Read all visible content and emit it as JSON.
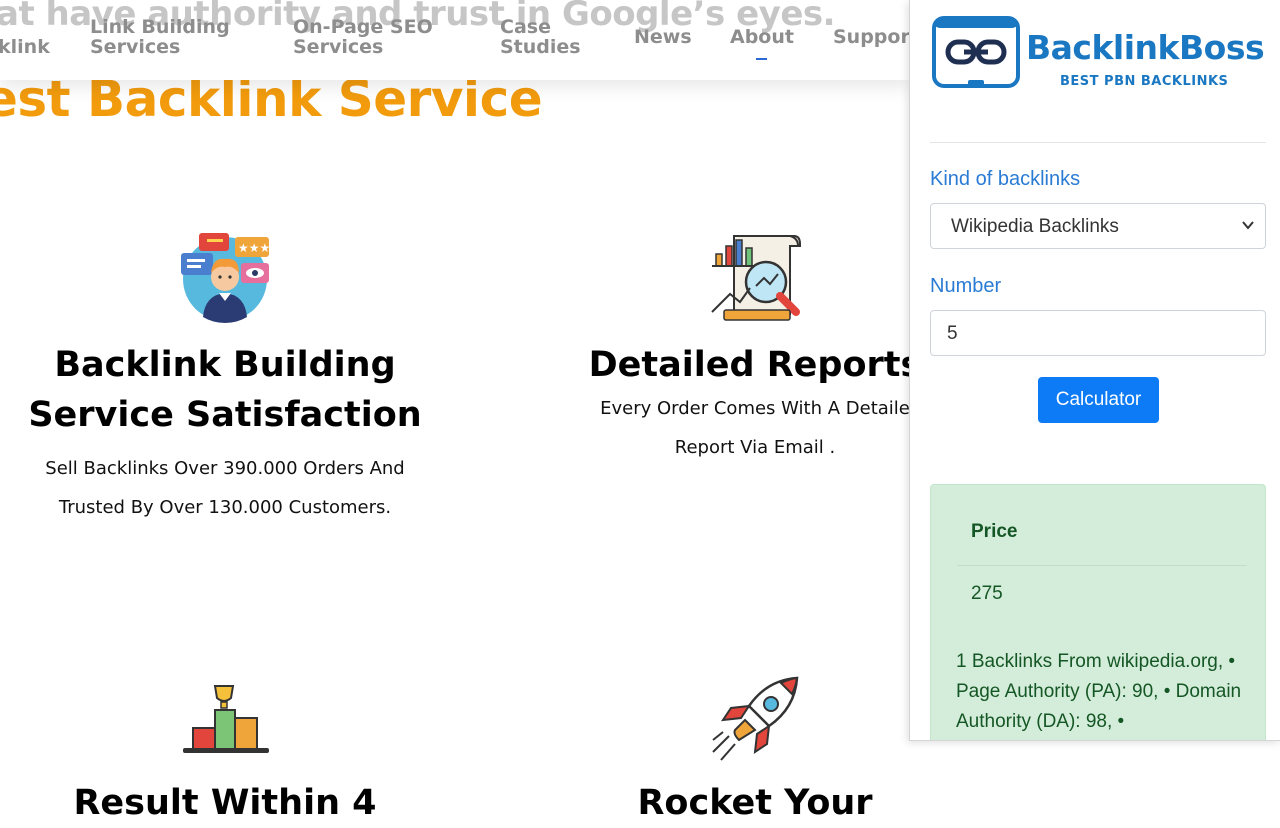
{
  "header": {
    "ghost_text": "at have authority and trust in Google’s eyes.",
    "nav": {
      "backlink": "klink",
      "link_building_1": "Link Building",
      "link_building_2": "Services",
      "onpage_1": "On-Page SEO",
      "onpage_2": "Services",
      "case_1": "Case",
      "case_2": "Studies",
      "news": "News",
      "about": "About",
      "support": "Support"
    }
  },
  "hero": {
    "title": "est Backlink Service"
  },
  "features": [
    {
      "title_1": "Backlink Building",
      "title_2": "Service Satisfaction",
      "text_1": "Sell Backlinks Over 390.000 Orders And",
      "text_2": "Trusted By Over 130.000 Customers."
    },
    {
      "title_1": "Detailed Reports",
      "text_1": "Every Order Comes With A Detaile",
      "text_2": "Report Via Email ."
    },
    {
      "title_1": "Result Within 4"
    },
    {
      "title_1": "Rocket Your"
    }
  ],
  "popup": {
    "logo_title": "BacklinkBoss",
    "logo_sub": "BEST PBN BACKLINKS",
    "kind_label": "Kind of backlinks",
    "kind_value": "Wikipedia Backlinks",
    "number_label": "Number",
    "number_value": "5",
    "button": "Calculator",
    "price_label": "Price",
    "price_value": "275",
    "description": "1 Backlinks From wikipedia.org, • Page Authority (PA): 90, • Domain Authority (DA): 98, •"
  },
  "icons": {
    "logo": "chain-link-icon",
    "feature1": "customer-review-icon",
    "feature2": "report-analysis-icon",
    "feature3": "podium-trophy-icon",
    "feature4": "rocket-icon",
    "select_arrow": "chevron-down-icon"
  },
  "colors": {
    "accent_orange": "#f29b0d",
    "brand_blue": "#1a77c2",
    "button_blue": "#0d7bf5",
    "success_bg": "#d4eddb",
    "success_text": "#155724"
  }
}
